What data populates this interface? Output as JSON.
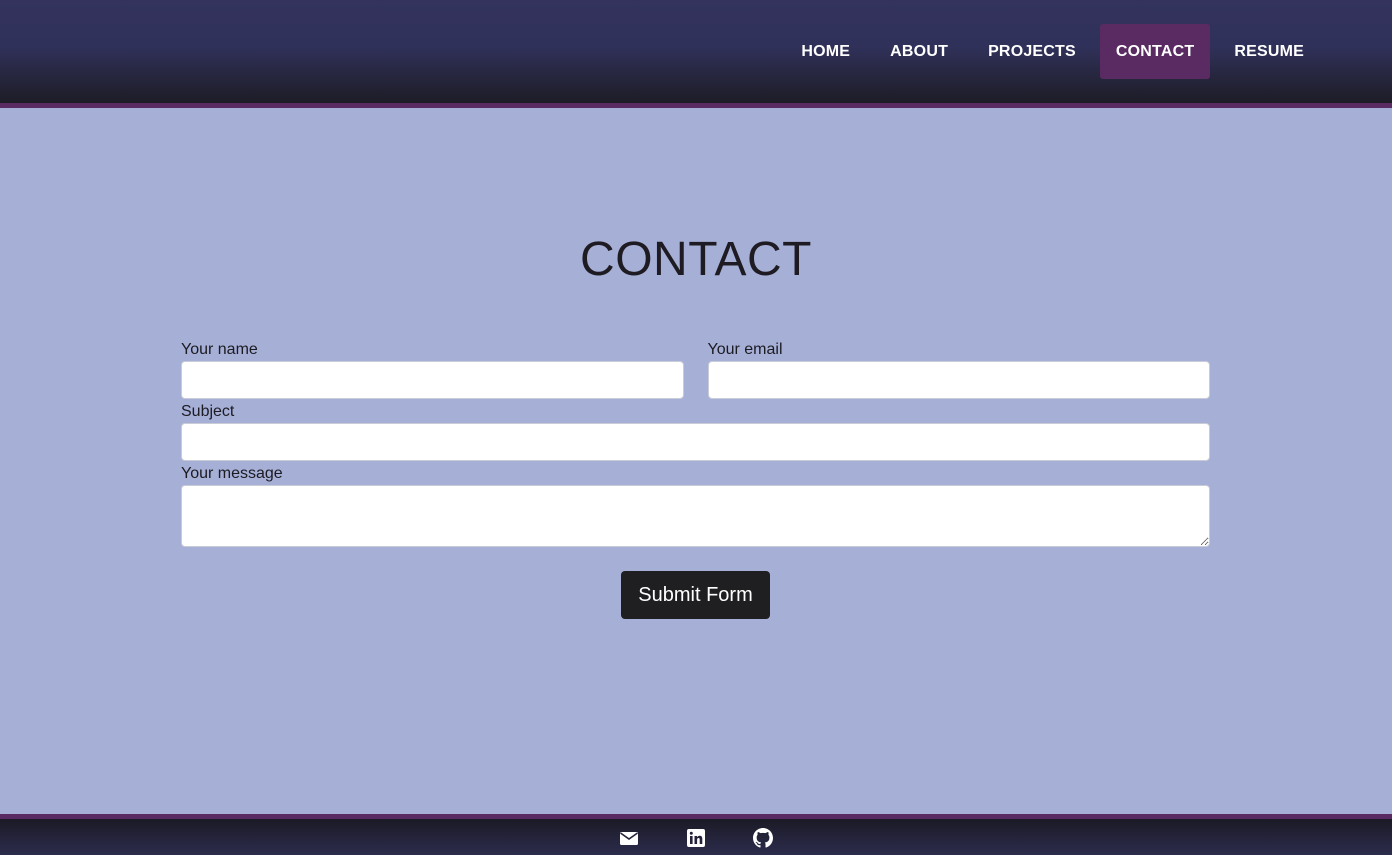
{
  "nav": {
    "items": [
      {
        "label": "HOME",
        "active": false
      },
      {
        "label": "ABOUT",
        "active": false
      },
      {
        "label": "PROJECTS",
        "active": false
      },
      {
        "label": "CONTACT",
        "active": true
      },
      {
        "label": "RESUME",
        "active": false
      }
    ]
  },
  "page": {
    "title": "CONTACT"
  },
  "form": {
    "name_label": "Your name",
    "name_value": "",
    "email_label": "Your email",
    "email_value": "",
    "subject_label": "Subject",
    "subject_value": "",
    "message_label": "Your message",
    "message_value": "",
    "submit_label": "Submit Form"
  },
  "footer": {
    "icons": [
      "envelope-icon",
      "linkedin-icon",
      "github-icon"
    ]
  },
  "colors": {
    "page_background": "#a6b0d7",
    "nav_top": "#33335e",
    "nav_bottom": "#1d1c26",
    "accent": "#5a2b63",
    "button": "#1f1f22"
  }
}
